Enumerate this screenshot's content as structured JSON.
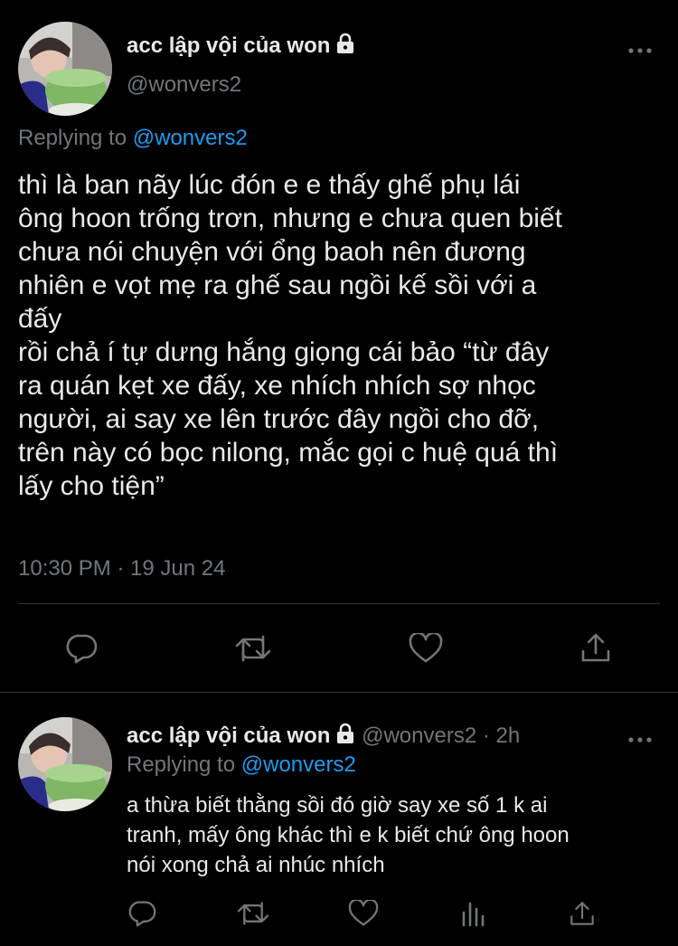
{
  "main_tweet": {
    "display_name": "acc lập vội của won",
    "handle": "@wonvers2",
    "replying_prefix": "Replying to ",
    "replying_to": "@wonvers2",
    "text": "thì là ban nãy lúc đón e e thấy ghế phụ lái\nông hoon trống trơn, nhưng e chưa quen biết\nchưa nói chuyện với ổng baoh nên đương\nnhiên e vọt mẹ ra ghế sau ngồi kế sồi với a\nđấy\nrồi chả í tự dưng hắng giọng cái bảo “từ đây\nra quán kẹt xe đấy, xe nhích nhích sợ nhọc\nngười, ai say xe lên trước đây ngồi cho đỡ,\ntrên này có bọc nilong, mắc gọi c huệ quá thì\nlấy cho tiện”",
    "timestamp": "10:30 PM · 19 Jun 24",
    "actions": [
      "reply-icon",
      "retweet-icon",
      "like-icon",
      "share-icon"
    ]
  },
  "reply_tweet": {
    "display_name": "acc lập vội của won",
    "handle_time": "@wonvers2 · 2h",
    "replying_prefix": "Replying to ",
    "replying_to": "@wonvers2",
    "text": "a thừa biết thằng sồi đó giờ say xe số 1 k ai\ntranh, mấy ông khác thì e k biết chứ ông hoon\nnói xong chả ai nhúc nhích",
    "actions": [
      "reply-icon",
      "retweet-icon",
      "like-icon",
      "analytics-icon",
      "share-icon"
    ]
  },
  "colors": {
    "background": "#000000",
    "text": "#e7e9ea",
    "secondary": "#71767b",
    "accent": "#1d9bf0",
    "divider": "#2f3336"
  }
}
